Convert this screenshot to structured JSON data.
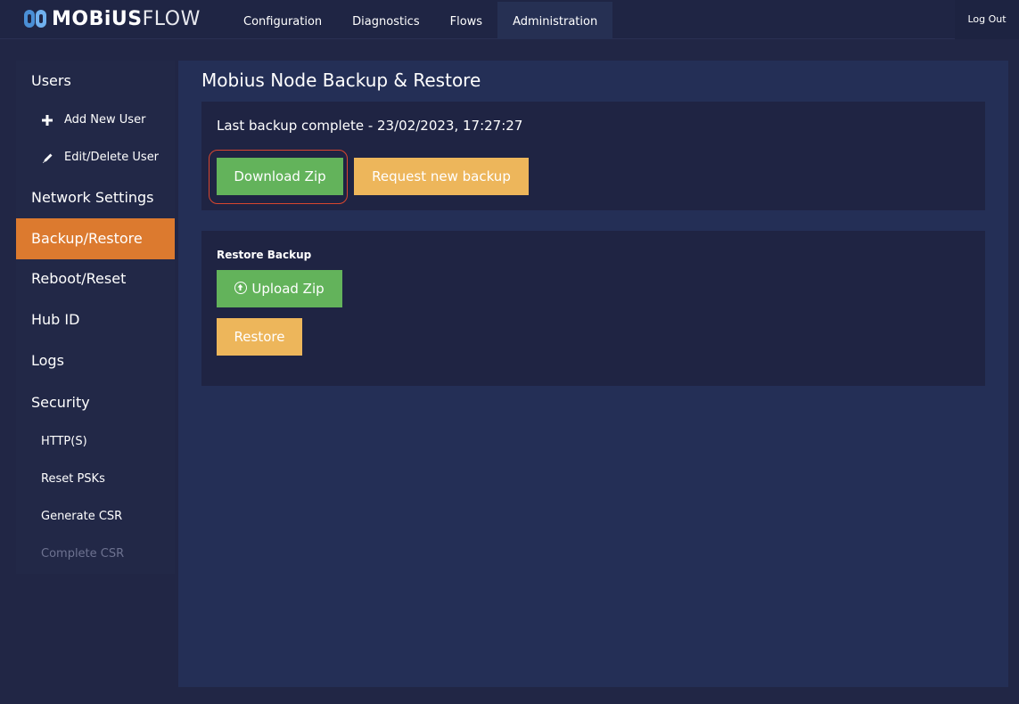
{
  "app": {
    "logo_bold": "MOBiUS",
    "logo_thin": "FLOW"
  },
  "nav": {
    "items": [
      "Configuration",
      "Diagnostics",
      "Flows",
      "Administration"
    ],
    "active": "Administration",
    "logout_label": "Log Out"
  },
  "sidebar": {
    "users": "Users",
    "add_new_user": "Add New User",
    "edit_delete_user": "Edit/Delete User",
    "network_settings": "Network Settings",
    "backup_restore": "Backup/Restore",
    "reboot_reset": "Reboot/Reset",
    "hub_id": "Hub ID",
    "logs": "Logs",
    "security": "Security",
    "https": "HTTP(S)",
    "reset_psks": "Reset PSKs",
    "generate_csr": "Generate CSR",
    "complete_csr": "Complete CSR",
    "active": "Backup/Restore"
  },
  "main": {
    "title": "Mobius Node Backup & Restore",
    "last_backup": "Last backup complete - 23/02/2023, 17:27:27",
    "download_zip": "Download Zip",
    "request_new_backup": "Request new backup",
    "restore_backup_label": "Restore Backup",
    "upload_zip": "Upload Zip",
    "restore": "Restore"
  },
  "colors": {
    "accent_orange": "#dc7a2f",
    "green_button": "#63b35b",
    "yellow_button": "#edb65b",
    "highlight_ring": "#d9462e"
  }
}
